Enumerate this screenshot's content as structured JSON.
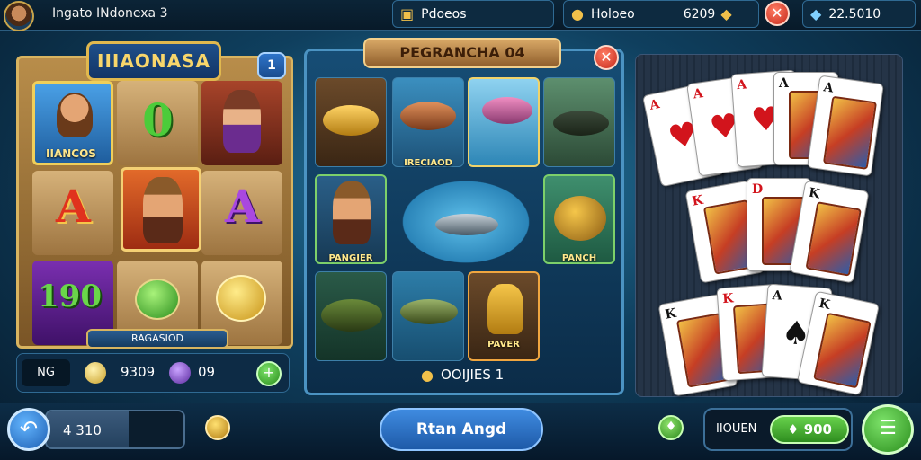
{
  "topbar": {
    "title": "Ingato INdonexa 3",
    "menu_pill": "Pdoeos",
    "coins_label": "Holoeo",
    "coins_value": "6209",
    "close_glyph": "✕",
    "gems_value": "22.5010"
  },
  "slot": {
    "title": "IIIAONASA",
    "badge": "1",
    "reel_caption": "IIANCOS",
    "symbol_a1": "A",
    "symbol_zero": "0",
    "symbol_a2": "A",
    "symbol_190": "190",
    "footer": "RAGASIOD",
    "stats_label": "NG",
    "stats_value1": "9309",
    "stats_value2": "09",
    "plus_glyph": "+"
  },
  "fishing": {
    "title": "PEGRANCHA 04",
    "close_glyph": "✕",
    "caption_top": "IRECIAOD",
    "caption_left": "PANGIER",
    "caption_right": "PANCH",
    "caption_bottom": "PAVER",
    "total": "OOIJIES 1"
  },
  "cards": {
    "row1": [
      {
        "rank": "A",
        "suit": "♥",
        "color": "red"
      },
      {
        "rank": "A",
        "suit": "♥",
        "color": "red"
      },
      {
        "rank": "A",
        "suit": "♥",
        "color": "red"
      },
      {
        "rank": "A",
        "suit": "♠",
        "color": "black"
      },
      {
        "rank": "A",
        "suit": "♠",
        "color": "black"
      }
    ],
    "row2": [
      {
        "rank": "K",
        "suit": "♥",
        "color": "red"
      },
      {
        "rank": "D",
        "suit": "♥",
        "color": "red"
      },
      {
        "rank": "K",
        "suit": "♠",
        "color": "black"
      }
    ],
    "row3": [
      {
        "rank": "K",
        "suit": "♣",
        "color": "black"
      },
      {
        "rank": "K",
        "suit": "♦",
        "color": "red"
      },
      {
        "rank": "A",
        "suit": "♠",
        "color": "black"
      },
      {
        "rank": "K",
        "suit": "♠",
        "color": "black"
      }
    ]
  },
  "bottom": {
    "back_glyph": "↶",
    "progress_text": "4 310",
    "progress_fraction": 0.6,
    "main_button": "Rtan Angd",
    "bet_label": "IIOUEN",
    "bet_value": "900",
    "bet_glyph": "♦",
    "menu_glyph": "☰"
  },
  "colors": {
    "accent_gold": "#e0b84e",
    "accent_green": "#2e8d1f",
    "accent_blue": "#1e5aa8",
    "close_red": "#c5281a"
  }
}
